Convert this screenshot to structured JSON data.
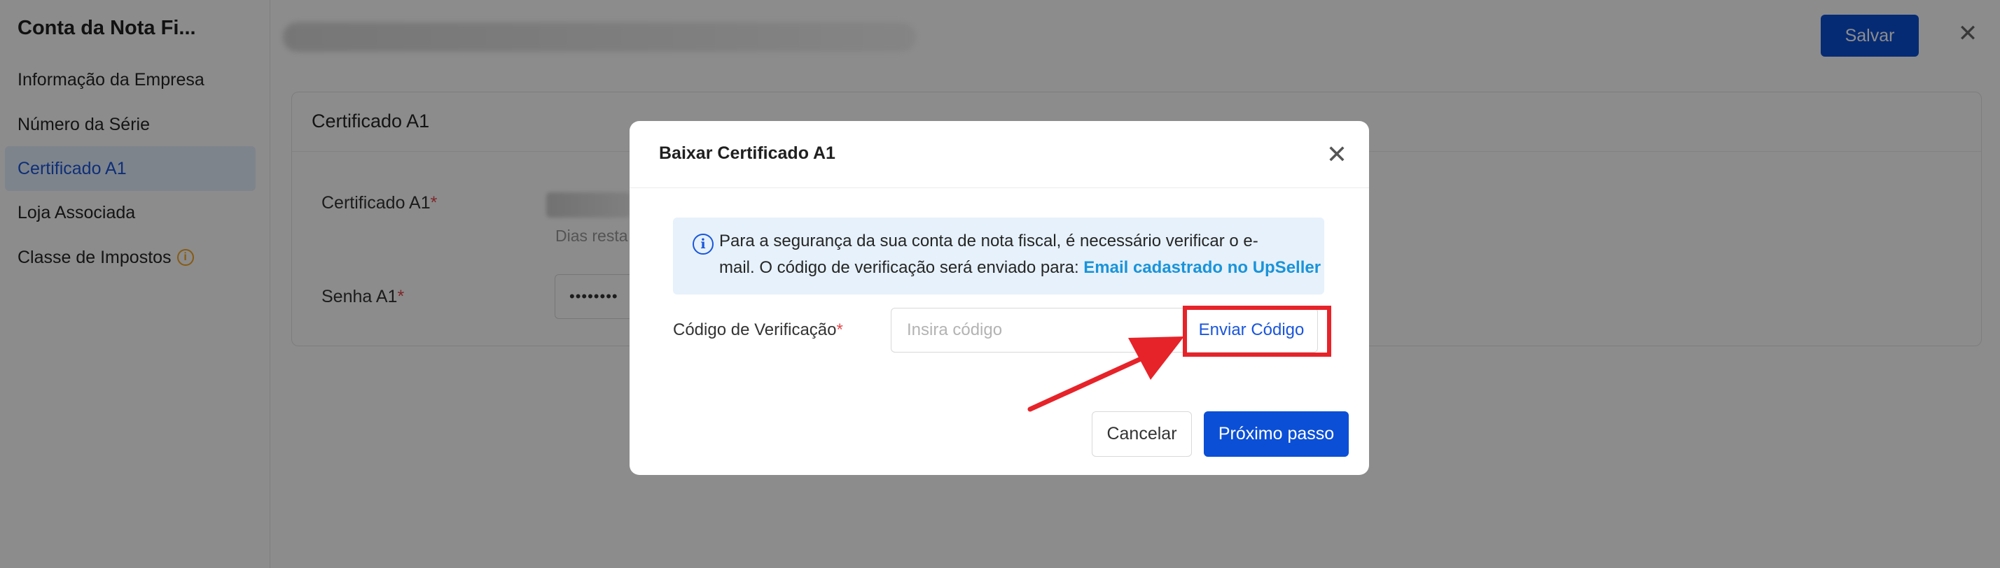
{
  "sidebar": {
    "title": "Conta da Nota Fi...",
    "items": [
      {
        "label": "Informação da Empresa"
      },
      {
        "label": "Número da Série"
      },
      {
        "label": "Certificado A1"
      },
      {
        "label": "Loja Associada"
      },
      {
        "label": "Classe de Impostos"
      }
    ],
    "active_index": 2
  },
  "toolbar": {
    "save_label": "Salvar",
    "close_icon": "close-icon"
  },
  "card": {
    "title": "Certificado A1",
    "cert_label": "Certificado A1",
    "days_text": "Dias resta",
    "password_label": "Senha A1",
    "password_value": "••••••••"
  },
  "modal": {
    "title": "Baixar Certificado A1",
    "info_line1": "Para a segurança da sua conta de nota fiscal, é necessário verificar o e-",
    "info_line2": "mail. O código de verificação será enviado para: ",
    "email_link": "Email cadastrado no UpSeller",
    "code_label": "Código de Verificação",
    "code_placeholder": "Insira código",
    "send_code_label": "Enviar Código",
    "cancel_label": "Cancelar",
    "next_label": "Próximo passo"
  },
  "colors": {
    "primary": "#0b4fd6",
    "link": "#1a93d9",
    "required": "#e5484d",
    "annotation": "#e62329",
    "warning": "#f5a623"
  }
}
